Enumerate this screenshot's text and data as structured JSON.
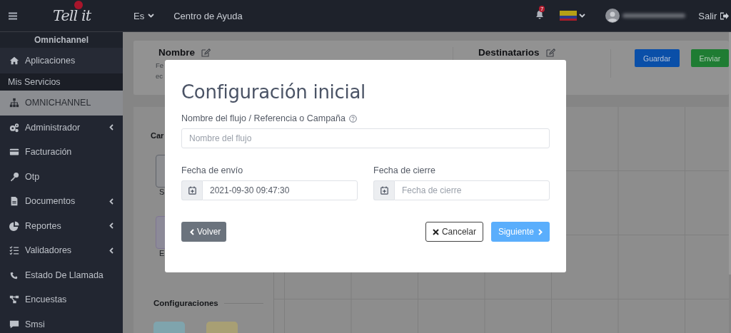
{
  "topbar": {
    "logo": "Tell it",
    "language": "Es",
    "help_link": "Centro de Ayuda",
    "notifications_count": "7",
    "logout": "Salir"
  },
  "sidebar": {
    "header": "Omnichannel",
    "items": [
      {
        "label": "Aplicaciones",
        "kind": "item",
        "selected": false,
        "has_submenu": false
      },
      {
        "label": "Mis Servicios",
        "kind": "section"
      },
      {
        "label": "OMNICHANNEL",
        "kind": "item",
        "selected": true,
        "has_submenu": false
      },
      {
        "label": "Administrador",
        "kind": "item",
        "selected": false,
        "has_submenu": true
      },
      {
        "label": "Facturación",
        "kind": "item",
        "selected": false,
        "has_submenu": false
      },
      {
        "label": "Otp",
        "kind": "item",
        "selected": false,
        "has_submenu": false
      },
      {
        "label": "Documentos",
        "kind": "item",
        "selected": false,
        "has_submenu": true
      },
      {
        "label": "Reportes",
        "kind": "item",
        "selected": false,
        "has_submenu": true
      },
      {
        "label": "Validadores",
        "kind": "item",
        "selected": false,
        "has_submenu": true
      },
      {
        "label": "Estado De Llamada",
        "kind": "item",
        "selected": false,
        "has_submenu": false
      },
      {
        "label": "Encuestas",
        "kind": "item",
        "selected": false,
        "has_submenu": false
      },
      {
        "label": "Smsi",
        "kind": "item",
        "selected": false,
        "has_submenu": false
      }
    ]
  },
  "page": {
    "name_label": "Nombre",
    "name_desc": [
      "Fe",
      "ec"
    ],
    "recipients_label": "Destinatarios",
    "buttons": [
      {
        "label": "Guardar",
        "kind": "primary"
      },
      {
        "label": "Enviar",
        "kind": "success"
      }
    ],
    "side_heading": "Car",
    "cards": [
      {
        "caption": "S",
        "color": "#5f636a"
      },
      {
        "caption": "E",
        "color": "#7f7693"
      }
    ],
    "config_heading": "Configuraciones"
  },
  "modal": {
    "title": "Configuración inicial",
    "fields": [
      {
        "kind": "text",
        "label": "Nombre del flujo / Referencia o Campaña",
        "help": true,
        "placeholder": "Nombre del flujo"
      },
      {
        "kind": "date",
        "label": "Fecha de envío",
        "value": "2021-09-30 09:47:30"
      },
      {
        "kind": "date",
        "label": "Fecha de cierre",
        "placeholder": "Fecha de cierre"
      }
    ],
    "buttons": [
      {
        "label": "Volver",
        "kind": "back"
      },
      {
        "label": "Cancelar",
        "kind": "cancel"
      },
      {
        "label": "Siguiente",
        "kind": "next"
      }
    ]
  }
}
